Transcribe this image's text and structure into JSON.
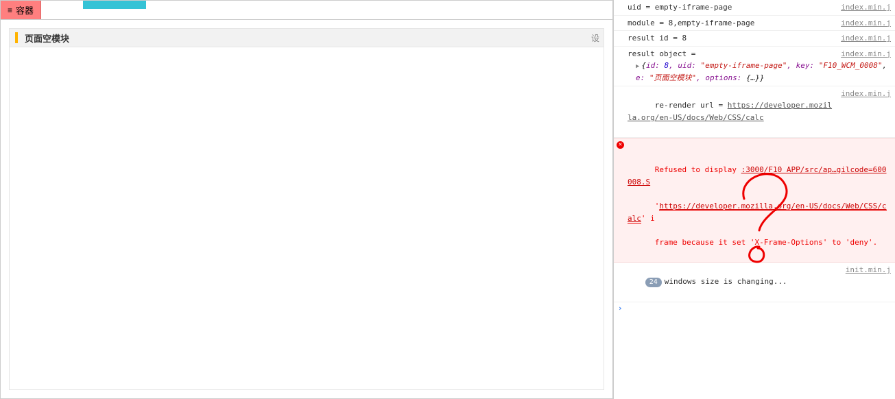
{
  "left": {
    "tab_label": "容器",
    "module_title": "页面空模块",
    "settings_hint": "设"
  },
  "console": {
    "lines": [
      {
        "type": "text",
        "msg": "uid = empty-iframe-page",
        "src": "index.min.j"
      },
      {
        "type": "text",
        "msg": "module = 8,empty-iframe-page",
        "src": "index.min.j"
      },
      {
        "type": "text",
        "msg": "result id = 8",
        "src": "index.min.j"
      },
      {
        "type": "text",
        "msg": "result object = ",
        "src": "index.min.j",
        "obj": "{id: 8, uid: \"empty-iframe-page\", key: \"F10_WCM_0008\", e: \"页面空模块\", options: {…}}"
      },
      {
        "type": "link",
        "prefix": "re-render url = ",
        "url": "https://developer.mozilla.org/en-US/docs/Web/CSS/calc",
        "src": "index.min.j"
      },
      {
        "type": "error",
        "line1a": "Refused to display ",
        "line1b": ":3000/F10 APP/src/ap…gilcode=600008.S",
        "line2a": "'",
        "line2b": "https://developer.mozilla.org/en-US/docs/Web/CSS/calc",
        "line2c": "' i",
        "line3": "frame because it set 'X-Frame-Options' to 'deny'."
      },
      {
        "type": "count",
        "count": 24,
        "msg": "windows size is changing...",
        "src": "init.min.j"
      }
    ],
    "prompt": "›"
  },
  "obj_literal": {
    "id_k": "id: ",
    "id_v": "8",
    "uid_k": ", uid: ",
    "uid_v": "\"empty-iframe-page\"",
    "key_k": ", key: ",
    "key_v": "\"F10_WCM_0008\"",
    "e_k": "e: ",
    "e_v": "\"页面空模块\"",
    "opt_k": ", options: ",
    "opt_v": "{…}"
  }
}
